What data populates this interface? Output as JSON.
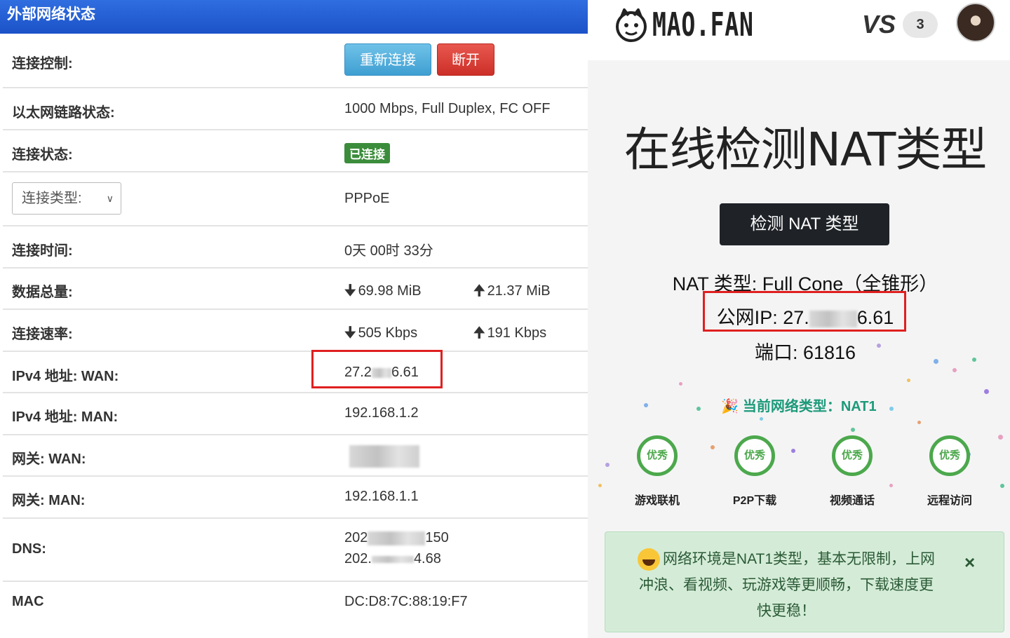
{
  "left": {
    "header_title": "外部网络状态",
    "rows": {
      "control": {
        "label": "连接控制:",
        "reconnect": "重新连接",
        "disconnect": "断开"
      },
      "ethernet": {
        "label": "以太网链路状态:",
        "value": "1000 Mbps, Full Duplex, FC OFF"
      },
      "status": {
        "label": "连接状态:",
        "badge": "已连接"
      },
      "conn_type": {
        "select": "连接类型:",
        "value": "PPPoE"
      },
      "uptime": {
        "label": "连接时间:",
        "value": "0天 00时 33分"
      },
      "traffic": {
        "label": "数据总量:",
        "down": "69.98 MiB",
        "up": "21.37 MiB"
      },
      "rate": {
        "label": "连接速率:",
        "down": "505 Kbps",
        "up": "191 Kbps"
      },
      "ipv4_wan": {
        "label": "IPv4 地址: WAN:",
        "value_a": "27.2",
        "value_b": "6.61"
      },
      "ipv4_man": {
        "label": "IPv4 地址: MAN:",
        "value": "192.168.1.2"
      },
      "gw_wan": {
        "label": "网关: WAN:"
      },
      "gw_man": {
        "label": "网关: MAN:",
        "value": "192.168.1.1"
      },
      "dns": {
        "label": "DNS:",
        "line1_a": "202",
        "line1_b": "150",
        "line2_a": "202.",
        "line2_b": "4.68"
      },
      "mac": {
        "label": "MAC",
        "value": "DC:D8:7C:88:19:F7"
      }
    }
  },
  "right": {
    "brand": "MAO.FAN",
    "vs": "VS",
    "vs_count": "3",
    "title": "在线检测NAT类型",
    "detect_button": "检测 NAT 类型",
    "nat_type_line": "NAT 类型: Full Cone（全锥形）",
    "public_ip_a": "公网IP: 27.",
    "public_ip_b": "6.61",
    "port_line": "端口: 61816",
    "current_network": "🎉 当前网络类型：NAT1",
    "rating": "优秀",
    "metrics": [
      "游戏联机",
      "P2P下载",
      "视频通话",
      "远程访问"
    ],
    "alert_text": "网络环境是NAT1类型，基本无限制，上网冲浪、看视频、玩游戏等更顺畅，下载速度更快更稳！",
    "alert_close": "×"
  }
}
